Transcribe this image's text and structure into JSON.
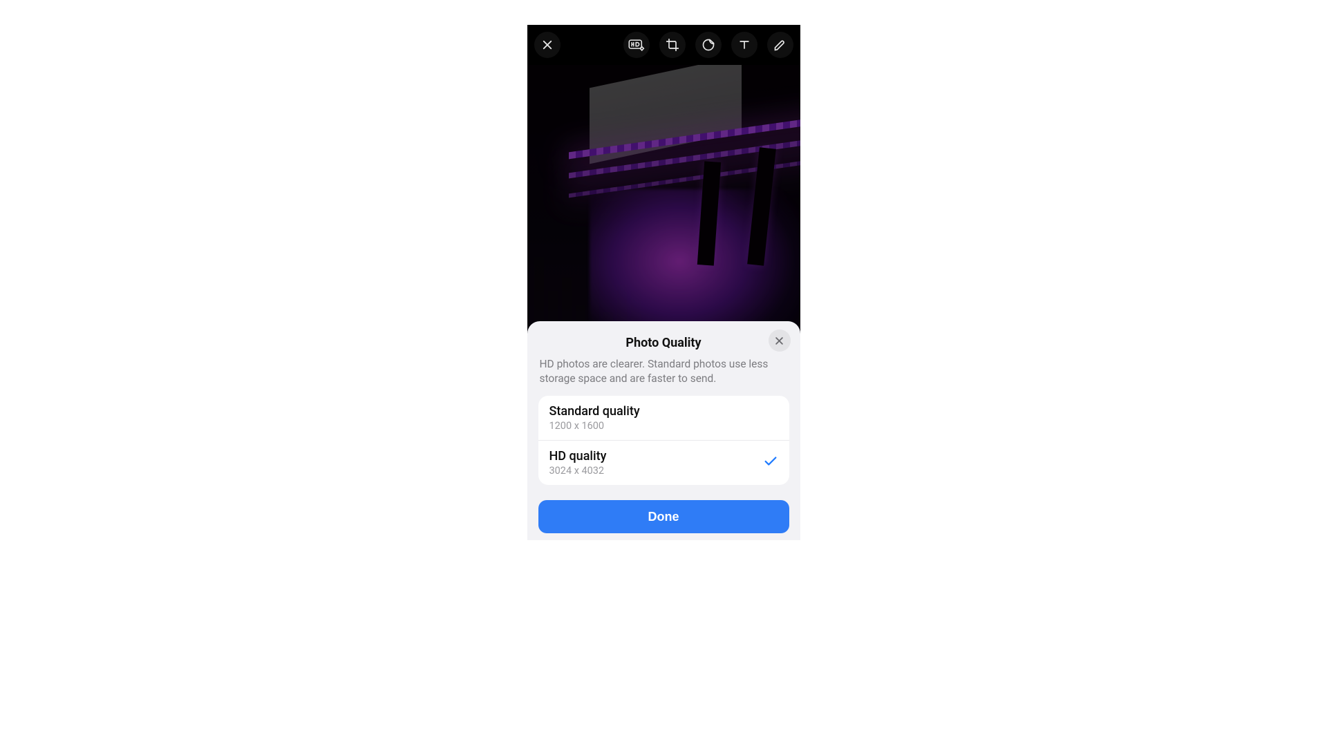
{
  "toolbar": {
    "icons": {
      "close": "close-icon",
      "hd": "hd-settings-icon",
      "crop": "crop-icon",
      "sticker": "sticker-icon",
      "text": "text-tool-icon",
      "draw": "draw-icon"
    }
  },
  "sheet": {
    "title": "Photo Quality",
    "description": "HD photos are clearer. Standard photos use less storage space and are faster to send.",
    "options": [
      {
        "title": "Standard quality",
        "sub": "1200 x 1600",
        "selected": false
      },
      {
        "title": "HD quality",
        "sub": "3024 x 4032",
        "selected": true
      }
    ],
    "done_label": "Done"
  },
  "colors": {
    "accent": "#2f7cf6",
    "check": "#1f7bff"
  }
}
